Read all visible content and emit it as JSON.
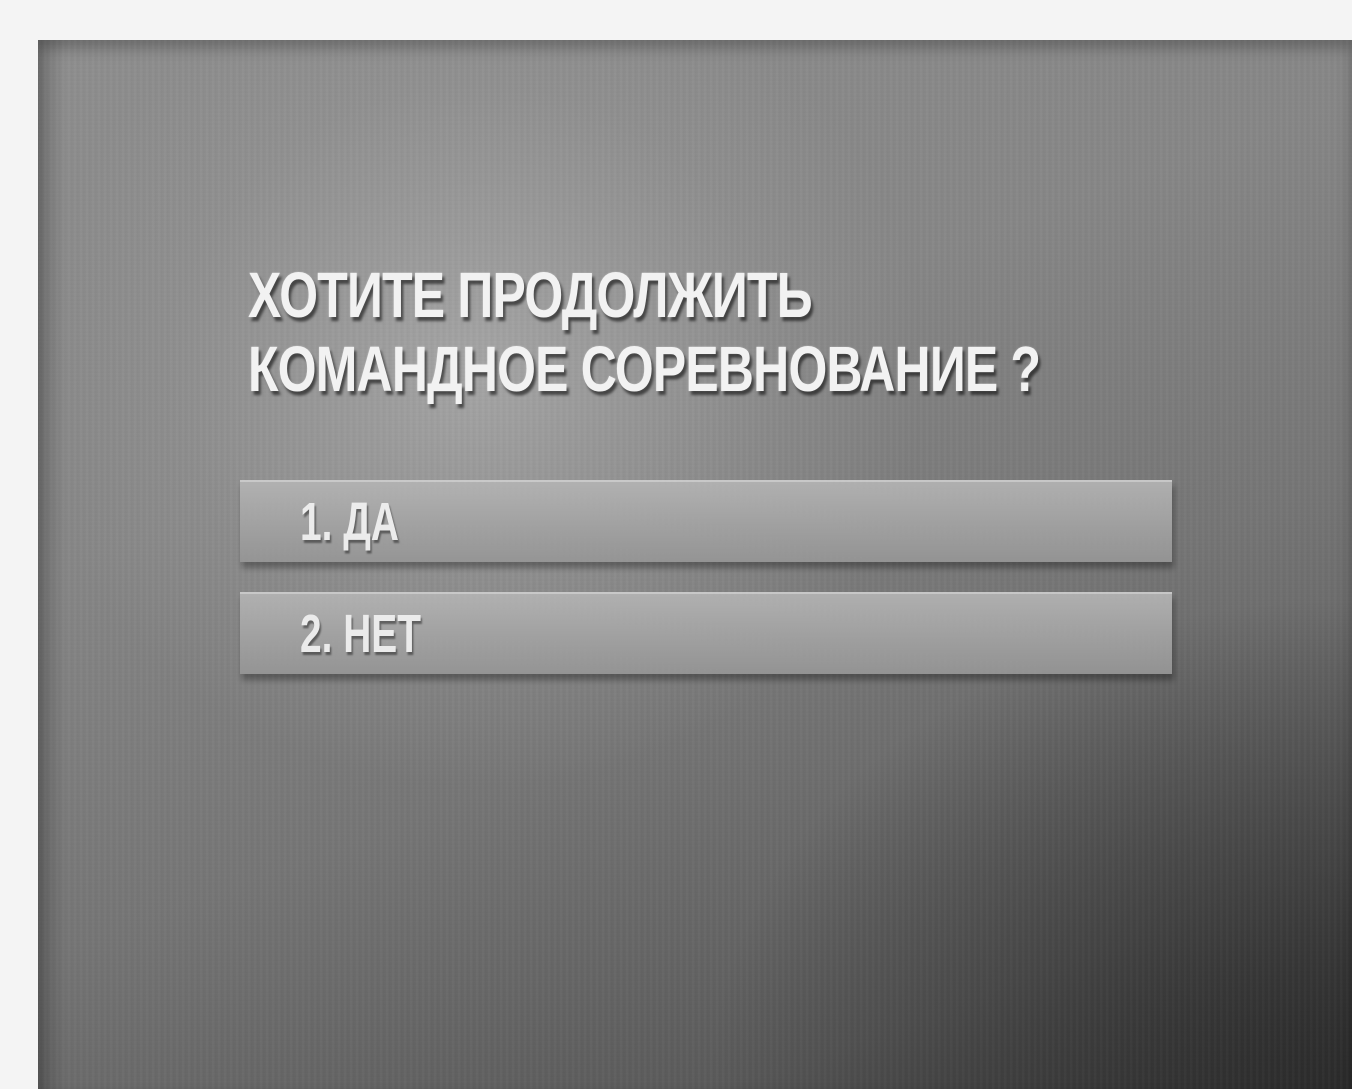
{
  "dialog": {
    "question_line1": "ХОТИТЕ ПРОДОЛЖИТЬ",
    "question_line2": "КОМАНДНОЕ СОРЕВНОВАНИЕ ?",
    "options": [
      {
        "label": "1. ДА"
      },
      {
        "label": "2. НЕТ"
      }
    ]
  },
  "colors": {
    "background": "#878787",
    "text": "#f2f2f2",
    "option_bar": "#a8a8a8"
  }
}
